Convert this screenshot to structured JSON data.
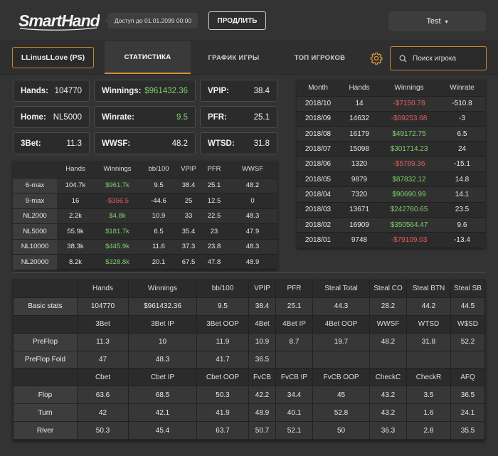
{
  "header": {
    "logo_text": "SmartHand",
    "access_text": "Доступ до 01.01.2099 00:00",
    "renew_label": "ПРОДЛИТЬ",
    "user_name": "Test",
    "user_chevron": "⌄"
  },
  "nav": {
    "player_name": "LLinusLLove (PS)",
    "tabs": [
      {
        "label": "СТАТИСТИКА",
        "active": true
      },
      {
        "label": "ГРАФИК ИГРЫ",
        "active": false
      },
      {
        "label": "ТОП ИГРОКОВ",
        "active": false
      }
    ],
    "settings_icon": "gear-icon",
    "search_icon": "search-icon",
    "search_placeholder": "Поиск игрока"
  },
  "summary": [
    [
      {
        "label": "Hands:",
        "value": "104770"
      },
      {
        "label": "Winnings:",
        "value": "$961432.36",
        "color": "green"
      },
      {
        "label": "VPIP:",
        "value": "38.4"
      }
    ],
    [
      {
        "label": "Home:",
        "value": "NL5000"
      },
      {
        "label": "Winrate:",
        "value": "9.5",
        "color": "green"
      },
      {
        "label": "PFR:",
        "value": "25.1"
      }
    ],
    [
      {
        "label": "3Bet:",
        "value": "11.3"
      },
      {
        "label": "WWSF:",
        "value": "48.2"
      },
      {
        "label": "WTSD:",
        "value": "31.8"
      }
    ]
  ],
  "limits_table": {
    "headers": [
      "",
      "Hands",
      "Winnings",
      "bb/100",
      "VPIP",
      "PFR",
      "WWSF"
    ],
    "rows": [
      {
        "label": "6-max",
        "hands": "104.7k",
        "winnings": "$961.7k",
        "wcolor": "green",
        "bb": "9.5",
        "vpip": "38.4",
        "pfr": "25.1",
        "wwsf": "48.2"
      },
      {
        "label": "9-max",
        "hands": "16",
        "winnings": "-$356.5",
        "wcolor": "red",
        "bb": "-44.6",
        "vpip": "25",
        "pfr": "12.5",
        "wwsf": "0"
      },
      {
        "label": "NL2000",
        "hands": "2.2k",
        "winnings": "$4.8k",
        "wcolor": "green",
        "bb": "10.9",
        "vpip": "33",
        "pfr": "22.5",
        "wwsf": "48.3"
      },
      {
        "label": "NL5000",
        "hands": "55.9k",
        "winnings": "$181.7k",
        "wcolor": "green",
        "bb": "6.5",
        "vpip": "35.4",
        "pfr": "23",
        "wwsf": "47.9"
      },
      {
        "label": "NL10000",
        "hands": "38.3k",
        "winnings": "$445.9k",
        "wcolor": "green",
        "bb": "11.6",
        "vpip": "37.3",
        "pfr": "23.8",
        "wwsf": "48.3"
      },
      {
        "label": "NL20000",
        "hands": "8.2k",
        "winnings": "$328.8k",
        "wcolor": "green",
        "bb": "20.1",
        "vpip": "67.5",
        "pfr": "47.8",
        "wwsf": "48.9"
      }
    ]
  },
  "month_table": {
    "headers": [
      "Month",
      "Hands",
      "Winnings",
      "Winrate"
    ],
    "rows": [
      {
        "month": "2018/10",
        "hands": "14",
        "winnings": "-$7150.78",
        "wcolor": "red",
        "winrate": "-510.8"
      },
      {
        "month": "2018/09",
        "hands": "14632",
        "winnings": "-$69253.68",
        "wcolor": "red",
        "winrate": "-3"
      },
      {
        "month": "2018/08",
        "hands": "16179",
        "winnings": "$49172.75",
        "wcolor": "green",
        "winrate": "6.5"
      },
      {
        "month": "2018/07",
        "hands": "15098",
        "winnings": "$301714.23",
        "wcolor": "green",
        "winrate": "24"
      },
      {
        "month": "2018/06",
        "hands": "1320",
        "winnings": "-$5789.36",
        "wcolor": "red",
        "winrate": "-15.1"
      },
      {
        "month": "2018/05",
        "hands": "9879",
        "winnings": "$87832.12",
        "wcolor": "green",
        "winrate": "14.8"
      },
      {
        "month": "2018/04",
        "hands": "7320",
        "winnings": "$90690.99",
        "wcolor": "green",
        "winrate": "14.1"
      },
      {
        "month": "2018/03",
        "hands": "13671",
        "winnings": "$242760.65",
        "wcolor": "green",
        "winrate": "23.5"
      },
      {
        "month": "2018/02",
        "hands": "16909",
        "winnings": "$350564.47",
        "wcolor": "green",
        "winrate": "9.6"
      },
      {
        "month": "2018/01",
        "hands": "9748",
        "winnings": "-$79109.03",
        "wcolor": "red",
        "winrate": "-13.4"
      }
    ]
  },
  "big_table": {
    "sections": [
      {
        "headers": [
          "",
          "Hands",
          "Winnings",
          "bb/100",
          "VPIP",
          "PFR",
          "Steal Total",
          "Steal CO",
          "Steal BTN",
          "Steal SB"
        ],
        "rows": [
          {
            "label": "Basic stats",
            "cells": [
              "104770",
              "$961432.36",
              "9.5",
              "38.4",
              "25.1",
              "44.3",
              "28.2",
              "44.2",
              "44.5"
            ]
          }
        ]
      },
      {
        "headers": [
          "",
          "3Bet",
          "3Bet IP",
          "3Bet OOP",
          "4Bet",
          "4Bet IP",
          "4Bet OOP",
          "WWSF",
          "WTSD",
          "W$SD"
        ],
        "rows": [
          {
            "label": "PreFlop",
            "cells": [
              "11.3",
              "10",
              "11.9",
              "10.9",
              "8.7",
              "19.7",
              "48.2",
              "31.8",
              "52.2"
            ]
          },
          {
            "label": "PreFlop Fold",
            "cells": [
              "47",
              "48.3",
              "41.7",
              "36.5",
              "",
              "",
              "",
              "",
              ""
            ]
          }
        ]
      },
      {
        "headers": [
          "",
          "Cbet",
          "Cbet IP",
          "Cbet OOP",
          "FvCB",
          "FvCB IP",
          "FvCB OOP",
          "CheckC",
          "CheckR",
          "AFQ"
        ],
        "rows": [
          {
            "label": "Flop",
            "cells": [
              "63.6",
              "68.5",
              "50.3",
              "42.2",
              "34.4",
              "45",
              "43.2",
              "3.5",
              "36.5"
            ]
          },
          {
            "label": "Turn",
            "cells": [
              "42",
              "42.1",
              "41.9",
              "48.9",
              "40.1",
              "52.8",
              "43.2",
              "1.6",
              "24.1"
            ]
          },
          {
            "label": "River",
            "cells": [
              "50.3",
              "45.4",
              "63.7",
              "50.7",
              "52.1",
              "50",
              "36.3",
              "2.8",
              "35.5"
            ]
          }
        ]
      }
    ]
  },
  "colors": {
    "accent": "#d08f38",
    "positive": "#7fcf6a",
    "negative": "#e35d5d",
    "background": "#333333"
  }
}
